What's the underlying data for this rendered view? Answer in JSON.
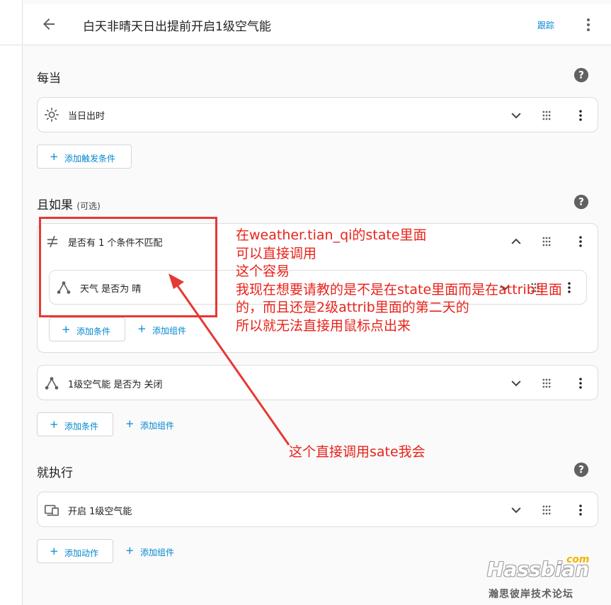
{
  "header": {
    "title": "白天非晴天日出提前开启1级空气能",
    "trace_label": "跟踪"
  },
  "triggers": {
    "title": "每当",
    "items": [
      {
        "label": "当日出时",
        "icon": "sun-icon"
      }
    ],
    "add_trigger_label": "添加触发条件"
  },
  "conditions": {
    "title": "且如果",
    "optional": "(可选)",
    "items": [
      {
        "label": "是否有 1 个条件不匹配",
        "icon": "not-equal-icon",
        "children": [
          {
            "label": "天气 是否为 晴",
            "icon": "state-icon"
          }
        ],
        "add_condition_label": "添加条件",
        "add_block_label": "添加组件"
      },
      {
        "label": "1级空气能 是否为 关闭",
        "icon": "state-icon"
      }
    ],
    "add_condition_label": "添加条件",
    "add_block_label": "添加组件"
  },
  "actions": {
    "title": "就执行",
    "items": [
      {
        "label": "开启 1级空气能",
        "icon": "device-icon"
      }
    ],
    "add_action_label": "添加动作",
    "add_block_label": "添加组件"
  },
  "annotation": {
    "lines": [
      "在weather.tian_qi的state里面",
      "可以直接调用",
      "这个容易",
      "我现在想要请教的是不是在state里面而是在attrib里面",
      "的，而且还是2级attrib里面的第二天的",
      "所以就无法直接用鼠标点出来"
    ],
    "note": "这个直接调用sate我会",
    "color": "#e8231b"
  },
  "watermark": {
    "brand": "Hassbian",
    "suffix": "com",
    "subtitle": "瀚思彼岸技术论坛"
  },
  "colors": {
    "accent": "#0288d1",
    "background": "#fafafa",
    "card": "#ffffff",
    "annotation": "#e53935"
  }
}
